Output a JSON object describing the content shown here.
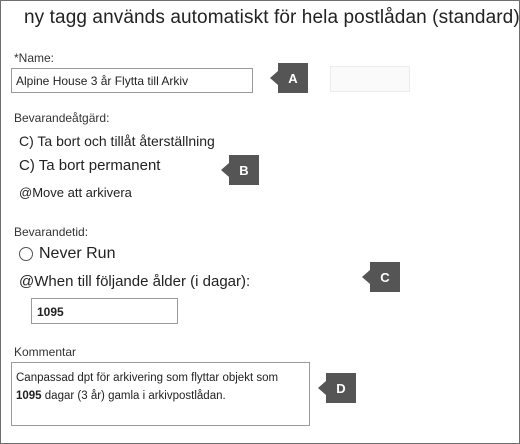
{
  "header": {
    "title": "ny tagg används automatiskt för hela postlådan (standard)"
  },
  "name_section": {
    "label": "*Name:",
    "value": "Alpine House 3 år Flytta till Arkiv"
  },
  "action_section": {
    "label": "Bevarandeåtgärd:",
    "options": [
      "C) Ta bort och tillåt återställning",
      "C) Ta bort permanent",
      "@Move att arkivera"
    ]
  },
  "period_section": {
    "label": "Bevarandetid:",
    "never_run": "Never Run",
    "when_age": "@When till följande ålder (i dagar):",
    "days_value": "1095"
  },
  "comment_section": {
    "label": "Kommentar",
    "line1": "Canpassad dpt för arkivering som flyttar objekt som",
    "line2_number": "1095",
    "line2_rest": " dagar (3 år) gamla i arkivpostlådan."
  },
  "callouts": {
    "a": "A",
    "b": "B",
    "c": "C",
    "d": "D"
  },
  "colors": {
    "callout": "#555555",
    "border": "#6e6e6e"
  }
}
